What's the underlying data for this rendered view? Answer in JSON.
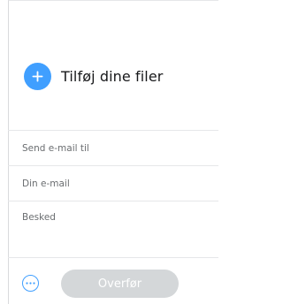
{
  "upload": {
    "add_files_label": "Tilføj dine filer"
  },
  "form": {
    "email_to_placeholder": "Send e-mail til",
    "your_email_placeholder": "Din e-mail",
    "message_placeholder": "Besked"
  },
  "footer": {
    "transfer_label": "Overfør"
  },
  "icons": {
    "add": "plus-icon",
    "more": "more-options-icon"
  },
  "colors": {
    "accent": "#409fff",
    "disabled_button": "#d4d7d9",
    "text": "#17181a",
    "placeholder": "#6a6d70"
  }
}
